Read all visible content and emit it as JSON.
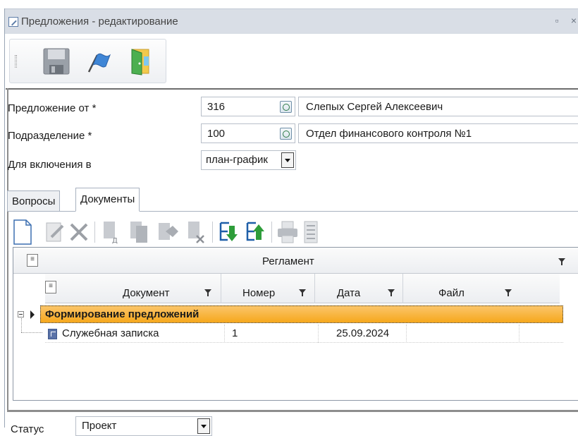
{
  "window": {
    "title": "Предложения - редактирование",
    "restore_glyph": "▫",
    "close_glyph": "×"
  },
  "toolbar": {
    "items": [
      {
        "name": "save-icon"
      },
      {
        "name": "flag-icon"
      },
      {
        "name": "exit-door-icon"
      }
    ]
  },
  "form": {
    "proposal_from": {
      "label": "Предложение от *",
      "code": "316",
      "name": "Слепых Сергей Алексеевич"
    },
    "department": {
      "label": "Подразделение *",
      "code": "100",
      "name": "Отдел финансового контроля №1"
    },
    "include_in": {
      "label": "Для включения в",
      "value": "план-график"
    }
  },
  "tabs": [
    {
      "label": "Вопросы",
      "active": false
    },
    {
      "label": "Документы",
      "active": true
    }
  ],
  "doc_toolbar": {
    "icons": [
      "new-document-icon",
      "edit-document-icon",
      "delete-icon",
      "document-d-icon",
      "documents-icon",
      "document-open-icon",
      "document-remove-icon",
      "import-icon",
      "export-icon",
      "print-icon",
      "report-icon"
    ]
  },
  "grid": {
    "band_title": "Регламент",
    "columns": [
      "Документ",
      "Номер",
      "Дата",
      "Файл"
    ],
    "group": {
      "label": "Формирование предложений"
    },
    "rows": [
      {
        "document": "Служебная записка",
        "number": "1",
        "date": "25.09.2024",
        "file": ""
      }
    ]
  },
  "status": {
    "label": "Статус",
    "value": "Проект"
  },
  "colors": {
    "group_row": "#f6a81c",
    "title_bar": "#d9dee6"
  }
}
